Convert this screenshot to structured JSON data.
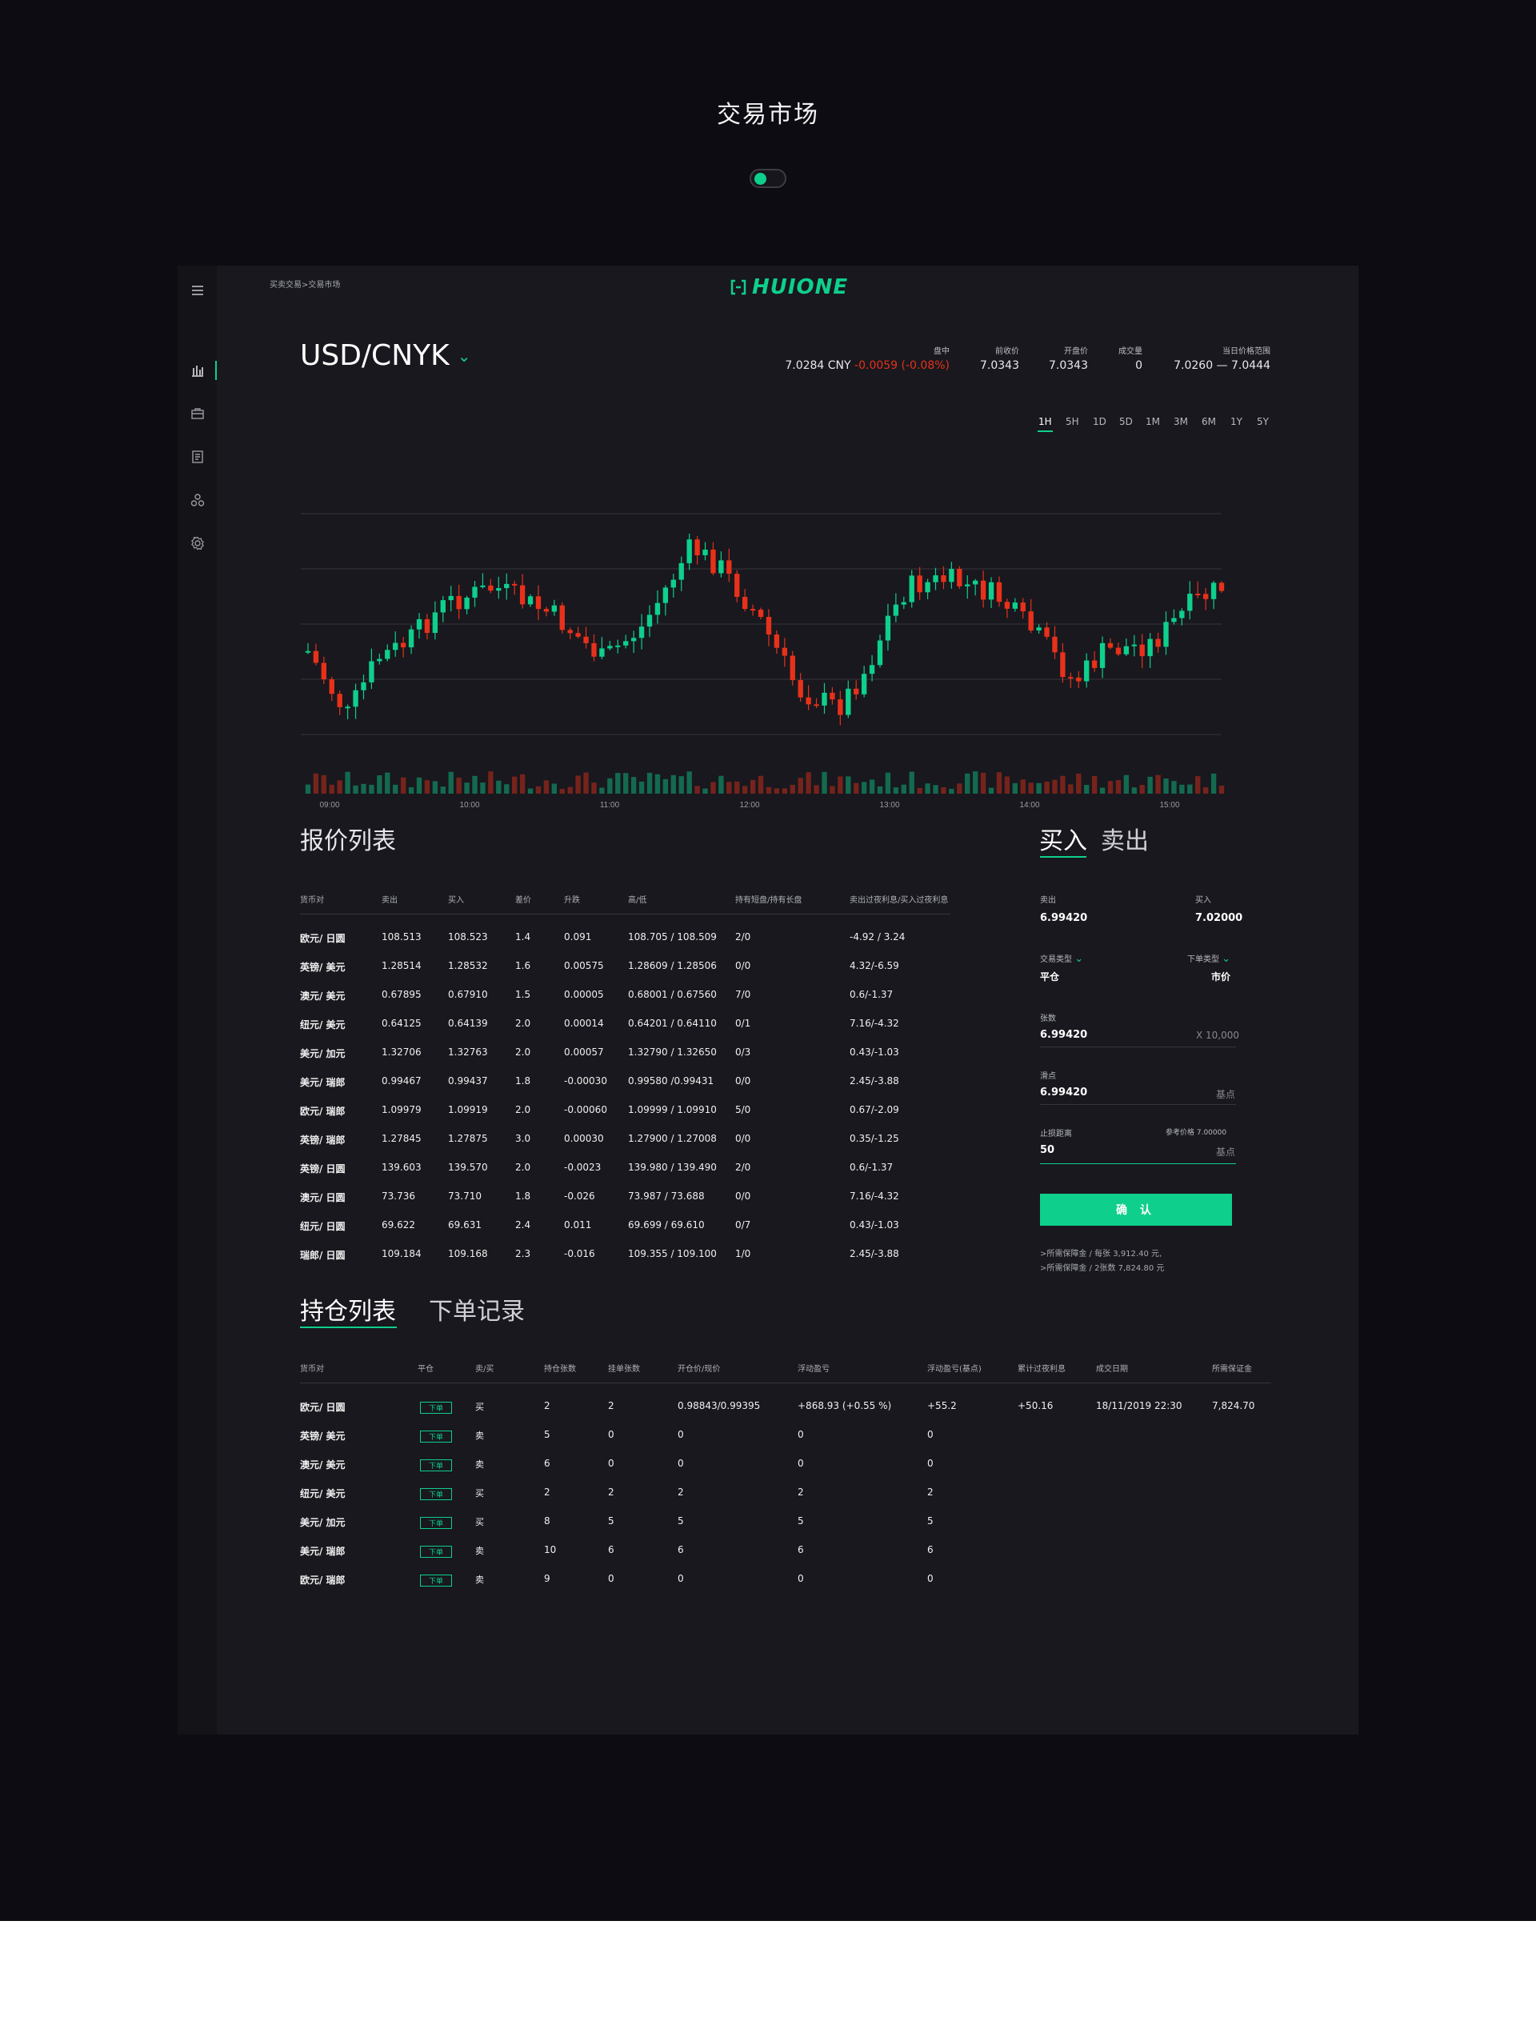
{
  "page": {
    "title": "交易市场"
  },
  "breadcrumb": "买卖交易>交易市场",
  "logo": {
    "text": "HUIONE"
  },
  "pair": {
    "label": "USD/CNYK"
  },
  "stats": {
    "mid": {
      "label": "盘中",
      "price": "7.0284 CNY",
      "change": "-0.0059 (-0.08%)"
    },
    "prev_close": {
      "label": "前收价",
      "value": "7.0343"
    },
    "open": {
      "label": "开盘价",
      "value": "7.0343"
    },
    "volume": {
      "label": "成交量",
      "value": "0"
    },
    "day_range": {
      "label": "当日价格范围",
      "value": "7.0260 — 7.0444"
    }
  },
  "ranges": [
    "1H",
    "5H",
    "1D",
    "5D",
    "1M",
    "3M",
    "6M",
    "1Y",
    "5Y"
  ],
  "active_range": "1H",
  "colors": {
    "accent": "#0fcf8c",
    "up": "#0fcf8c",
    "down": "#e8311a"
  },
  "chart_data": {
    "type": "candlestick",
    "x_ticks": [
      "09:00",
      "10:00",
      "11:00",
      "12:00",
      "13:00",
      "14:00",
      "15:00"
    ],
    "grid": true
  },
  "quotes": {
    "title": "报价列表",
    "headers": [
      "货币对",
      "卖出",
      "买入",
      "差价",
      "升跌",
      "高/低",
      "持有短盘/持有长盘",
      "卖出过夜利息/买入过夜利息"
    ],
    "rows": [
      {
        "pair": "欧元/ 日圆",
        "sell": "108.513",
        "buy": "108.523",
        "spread": "1.4",
        "change": "0.091",
        "hl": "108.705 / 108.509",
        "hold": "2/0",
        "overnight": "-4.92 / 3.24",
        "dir": "up"
      },
      {
        "pair": "英镑/ 美元",
        "sell": "1.28514",
        "buy": "1.28532",
        "spread": "1.6",
        "change": "0.00575",
        "hl": "1.28609 / 1.28506",
        "hold": "0/0",
        "overnight": "4.32/-6.59",
        "dir": "up"
      },
      {
        "pair": "澳元/ 美元",
        "sell": "0.67895",
        "buy": "0.67910",
        "spread": "1.5",
        "change": "0.00005",
        "hl": "0.68001 / 0.67560",
        "hold": "7/0",
        "overnight": "0.6/-1.37",
        "dir": "up"
      },
      {
        "pair": "纽元/ 美元",
        "sell": "0.64125",
        "buy": "0.64139",
        "spread": "2.0",
        "change": "0.00014",
        "hl": "0.64201 / 0.64110",
        "hold": "0/1",
        "overnight": "7.16/-4.32",
        "dir": "up"
      },
      {
        "pair": "美元/ 加元",
        "sell": "1.32706",
        "buy": "1.32763",
        "spread": "2.0",
        "change": "0.00057",
        "hl": "1.32790 / 1.32650",
        "hold": "0/3",
        "overnight": "0.43/-1.03",
        "dir": "up"
      },
      {
        "pair": "美元/ 瑞郎",
        "sell": "0.99467",
        "buy": "0.99437",
        "spread": "1.8",
        "change": "-0.00030",
        "hl": "0.99580 /0.99431",
        "hold": "0/0",
        "overnight": "2.45/-3.88",
        "dir": "down"
      },
      {
        "pair": "欧元/ 瑞郎",
        "sell": "1.09979",
        "buy": "1.09919",
        "spread": "2.0",
        "change": "-0.00060",
        "hl": "1.09999 / 1.09910",
        "hold": "5/0",
        "overnight": "0.67/-2.09",
        "dir": "down"
      },
      {
        "pair": "英镑/ 瑞郎",
        "sell": "1.27845",
        "buy": "1.27875",
        "spread": "3.0",
        "change": "0.00030",
        "hl": "1.27900 / 1.27008",
        "hold": "0/0",
        "overnight": "0.35/-1.25",
        "dir": "up"
      },
      {
        "pair": "英镑/ 日圆",
        "sell": "139.603",
        "buy": "139.570",
        "spread": "2.0",
        "change": "-0.0023",
        "hl": "139.980 / 139.490",
        "hold": "2/0",
        "overnight": "0.6/-1.37",
        "dir": "down"
      },
      {
        "pair": "澳元/ 日圆",
        "sell": "73.736",
        "buy": "73.710",
        "spread": "1.8",
        "change": "-0.026",
        "hl": "73.987  /  73.688",
        "hold": "0/0",
        "overnight": "7.16/-4.32",
        "dir": "down"
      },
      {
        "pair": "纽元/ 日圆",
        "sell": "69.622",
        "buy": "69.631",
        "spread": "2.4",
        "change": "0.011",
        "hl": "69.699  /  69.610",
        "hold": "0/7",
        "overnight": "0.43/-1.03",
        "dir": "up"
      },
      {
        "pair": "瑞郎/ 日圆",
        "sell": "109.184",
        "buy": "109.168",
        "spread": "2.3",
        "change": "-0.016",
        "hl": "109.355 / 109.100",
        "hold": "1/0",
        "overnight": "2.45/-3.88",
        "dir": "down"
      }
    ]
  },
  "trade": {
    "tab_buy": "买入",
    "tab_sell": "卖出",
    "sell_label": "卖出",
    "sell_value": "6.99420",
    "buy_label": "买入",
    "buy_value": "7.02000",
    "trade_type_label": "交易类型",
    "trade_type_value": "平仓",
    "order_type_label": "下单类型",
    "order_type_value": "市价",
    "lots_label": "张数",
    "lots_value": "6.99420",
    "lots_unit": "X 10,000",
    "slippage_label": "滑点",
    "slippage_value": "6.99420",
    "slippage_unit": "基点",
    "stoploss_label": "止损距离",
    "ref_price": "参考价格 7.00000",
    "stoploss_value": "50",
    "stoploss_unit": "基点",
    "confirm": "确 认",
    "note1": ">所需保障金 / 每张 3,912.40 元,",
    "note2": ">所需保障金 / 2张数 7,824.80 元"
  },
  "positions": {
    "tab_positions": "持仓列表",
    "tab_orders": "下单记录",
    "headers": [
      "货币对",
      "平仓",
      "卖/买",
      "持仓张数",
      "挂单张数",
      "开仓价/现价",
      "浮动盈亏",
      "浮动盈亏(基点)",
      "累计过夜利息",
      "成交日期",
      "所需保证金"
    ],
    "rows": [
      {
        "pair": "欧元/ 日圆",
        "tag": "下单",
        "side": "买",
        "sdir": "up",
        "held": "2",
        "pending": "2",
        "price": "0.98843/0.99395",
        "pnl": "+868.93  (+0.55 %)",
        "pnl_bp": "+55.2",
        "interest": "+50.16",
        "date": "18/11/2019 22:30",
        "margin": "7,824.70"
      },
      {
        "pair": "英镑/ 美元",
        "tag": "下单",
        "side": "卖",
        "sdir": "down",
        "held": "5",
        "pending": "0",
        "price": "0",
        "pnl": "0",
        "pnl_bp": "0",
        "interest": "",
        "date": "",
        "margin": ""
      },
      {
        "pair": "澳元/ 美元",
        "tag": "下单",
        "side": "卖",
        "sdir": "down",
        "held": "6",
        "pending": "0",
        "price": "0",
        "pnl": "0",
        "pnl_bp": "0",
        "interest": "",
        "date": "",
        "margin": ""
      },
      {
        "pair": "纽元/ 美元",
        "tag": "下单",
        "side": "买",
        "sdir": "up",
        "held": "2",
        "pending": "2",
        "price": "2",
        "pnl": "2",
        "pnl_bp": "2",
        "interest": "",
        "date": "",
        "margin": ""
      },
      {
        "pair": "美元/ 加元",
        "tag": "下单",
        "side": "买",
        "sdir": "up",
        "held": "8",
        "pending": "5",
        "price": "5",
        "pnl": "5",
        "pnl_bp": "5",
        "interest": "",
        "date": "",
        "margin": ""
      },
      {
        "pair": "美元/ 瑞郎",
        "tag": "下单",
        "side": "卖",
        "sdir": "down",
        "held": "10",
        "pending": "6",
        "price": "6",
        "pnl": "6",
        "pnl_bp": "6",
        "interest": "",
        "date": "",
        "margin": ""
      },
      {
        "pair": "欧元/ 瑞郎",
        "tag": "下单",
        "side": "卖",
        "sdir": "down",
        "held": "9",
        "pending": "0",
        "price": "0",
        "pnl": "0",
        "pnl_bp": "0",
        "interest": "",
        "date": "",
        "margin": ""
      }
    ]
  }
}
